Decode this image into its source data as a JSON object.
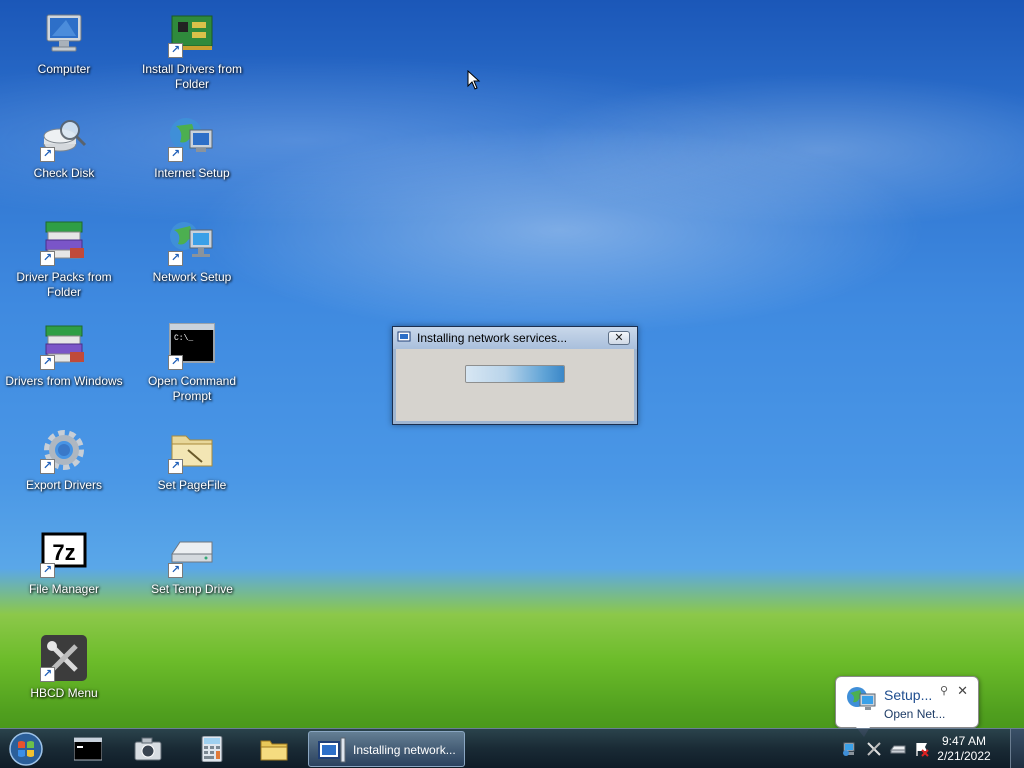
{
  "desktop": {
    "icons": [
      {
        "label": "Computer",
        "icon": "computer-icon"
      },
      {
        "label": "Install Drivers from Folder",
        "icon": "drivers-board-icon"
      },
      {
        "label": "Check Disk",
        "icon": "check-disk-icon"
      },
      {
        "label": "Internet Setup",
        "icon": "internet-setup-icon"
      },
      {
        "label": "Driver Packs from Folder",
        "icon": "driver-packs-icon"
      },
      {
        "label": "Network Setup",
        "icon": "network-setup-icon"
      },
      {
        "label": "Drivers from Windows",
        "icon": "drivers-windows-icon"
      },
      {
        "label": "Open Command Prompt",
        "icon": "command-prompt-icon"
      },
      {
        "label": "Export Drivers",
        "icon": "gear-icon"
      },
      {
        "label": "Set PageFile",
        "icon": "folder-icon"
      },
      {
        "label": "File Manager",
        "icon": "7zip-icon"
      },
      {
        "label": "Set Temp Drive",
        "icon": "drive-icon"
      },
      {
        "label": "HBCD Menu",
        "icon": "tools-icon"
      }
    ]
  },
  "dialog": {
    "title": "Installing network services...",
    "close_label": "✕",
    "progress_fraction": 1.0
  },
  "cmd_icon_text": "C:\\_",
  "sevenzip_text": "7z",
  "balloon": {
    "title": "Setup...",
    "text": "Open Net...",
    "close_label": "✕"
  },
  "taskbar": {
    "active_task_label": "Installing network...",
    "clock_time": "9:47 AM",
    "clock_date": "2/21/2022"
  },
  "colors": {
    "taskbar": "#1a2a3c",
    "dialog_body": "#d6d3ce",
    "progress_fill": "#5fa3d6",
    "balloon_title": "#1e4d8f"
  }
}
